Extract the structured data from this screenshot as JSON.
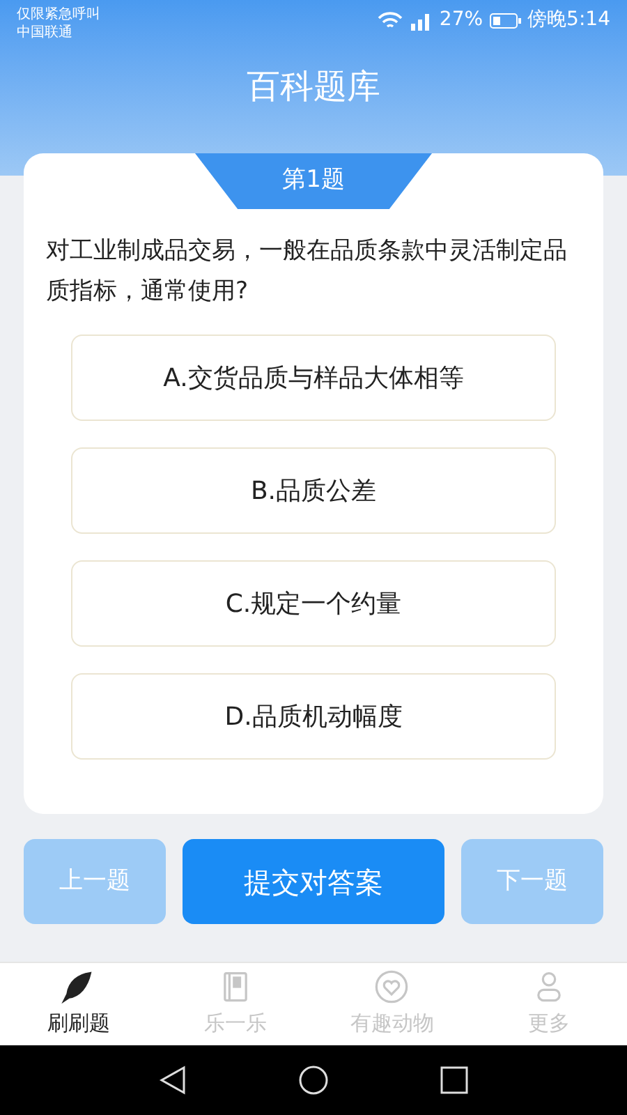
{
  "status_bar": {
    "carrier_lines": [
      "仅限紧急呼叫",
      "中国联通"
    ],
    "battery": "27%",
    "time": "傍晚5:14"
  },
  "header": {
    "title": "百科题库"
  },
  "question": {
    "number": "第1题",
    "text": "对工业制成品交易，一般在品质条款中灵活制定品质指标，通常使用?",
    "options": [
      "A.交货品质与样品大体相等",
      "B.品质公差",
      "C.规定一个约量",
      "D.品质机动幅度"
    ]
  },
  "actions": [
    {
      "label": "上一题",
      "kind": "secondary"
    },
    {
      "label": "提交对答案",
      "kind": "primary"
    },
    {
      "label": "下一题",
      "kind": "secondary"
    }
  ],
  "tabs": [
    {
      "label": "刷刷题",
      "kind": "feather",
      "selected": true
    },
    {
      "label": "乐一乐",
      "kind": "book",
      "selected": false
    },
    {
      "label": "有趣动物",
      "kind": "heart",
      "selected": false
    },
    {
      "label": "更多",
      "kind": "person",
      "selected": false
    }
  ]
}
